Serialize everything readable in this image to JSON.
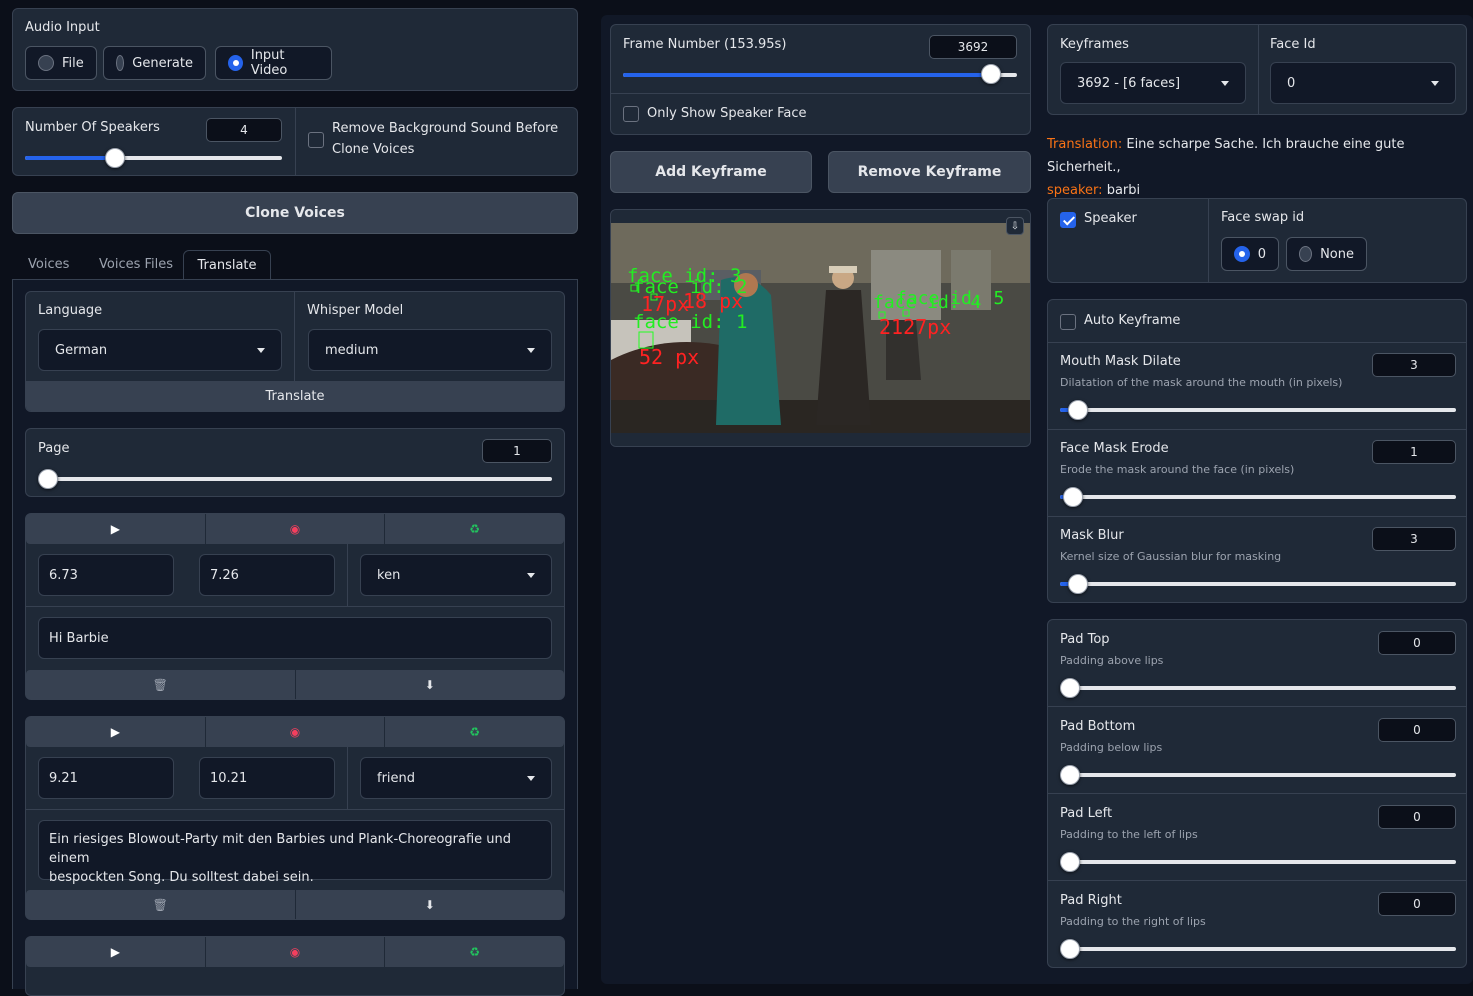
{
  "audio_input": {
    "label": "Audio Input",
    "options": [
      "File",
      "Generate",
      "Input Video"
    ],
    "selected": "Input Video"
  },
  "speakers": {
    "label": "Number Of Speakers",
    "value": "4",
    "remove_bg_line1": "Remove Background Sound Before",
    "remove_bg_line2": "Clone Voices"
  },
  "clone_button": "Clone Voices",
  "tabs": [
    "Voices",
    "Voices Files",
    "Translate"
  ],
  "active_tab": "Translate",
  "language": {
    "label": "Language",
    "value": "German"
  },
  "whisper": {
    "label": "Whisper Model",
    "value": "medium"
  },
  "translate_button": "Translate",
  "page": {
    "label": "Page",
    "value": "1"
  },
  "segments": [
    {
      "start": "6.73",
      "end": "7.26",
      "speaker": "ken",
      "text": "Hi Barbie"
    },
    {
      "start": "9.21",
      "end": "10.21",
      "speaker": "friend",
      "text_line1": "Ein riesiges Blowout-Party mit den Barbies und Plank-Choreografie und einem",
      "text_line2": "bespockten Song.  Du solltest dabei sein."
    }
  ],
  "segment_icons": {
    "play": "▶",
    "record": "◉",
    "recycle": "♻",
    "delete": "🗑",
    "down": "⬇"
  },
  "frame": {
    "label": "Frame Number (153.95s)",
    "value": "3692",
    "only_speaker": "Only Show Speaker Face"
  },
  "add_keyframe": "Add Keyframe",
  "remove_keyframe": "Remove Keyframe",
  "overlay_labels": {
    "face3": "face id: 3",
    "face2": "face id: 2",
    "face1": "face id: 1",
    "face4": "face id: 4",
    "face5": "face id: 5",
    "px1": "17px",
    "px2": "18 px",
    "px3": "52 px",
    "px4": "2127px"
  },
  "keyframes": {
    "label": "Keyframes",
    "value": "3692  - [6 faces]"
  },
  "face_id": {
    "label": "Face Id",
    "value": "0"
  },
  "translation": {
    "label": "Translation:",
    "text": "Eine scharpe Sache. Ich brauche eine gute Sicherheit.,",
    "speaker_label": "speaker:",
    "speaker": "barbi"
  },
  "speaker_check": "Speaker",
  "face_swap": {
    "label": "Face swap id",
    "options": [
      "0",
      "None"
    ],
    "selected": "0"
  },
  "auto_keyframe": "Auto Keyframe",
  "sliders": [
    {
      "label": "Mouth Mask Dilate",
      "desc": "Dilatation of the mask around the mouth (in pixels)",
      "value": "3"
    },
    {
      "label": "Face Mask Erode",
      "desc": "Erode the mask around the face (in pixels)",
      "value": "1"
    },
    {
      "label": "Mask Blur",
      "desc": "Kernel size of Gaussian blur for masking",
      "value": "3"
    }
  ],
  "pads": [
    {
      "label": "Pad Top",
      "desc": "Padding above lips",
      "value": "0"
    },
    {
      "label": "Pad Bottom",
      "desc": "Padding below lips",
      "value": "0"
    },
    {
      "label": "Pad Left",
      "desc": "Padding to the left of lips",
      "value": "0"
    },
    {
      "label": "Pad Right",
      "desc": "Padding to the right of lips",
      "value": "0"
    }
  ],
  "colors": {
    "accent": "#2563eb",
    "orange": "#f97316",
    "panel": "#1f2937",
    "bg": "#0b0f19"
  }
}
